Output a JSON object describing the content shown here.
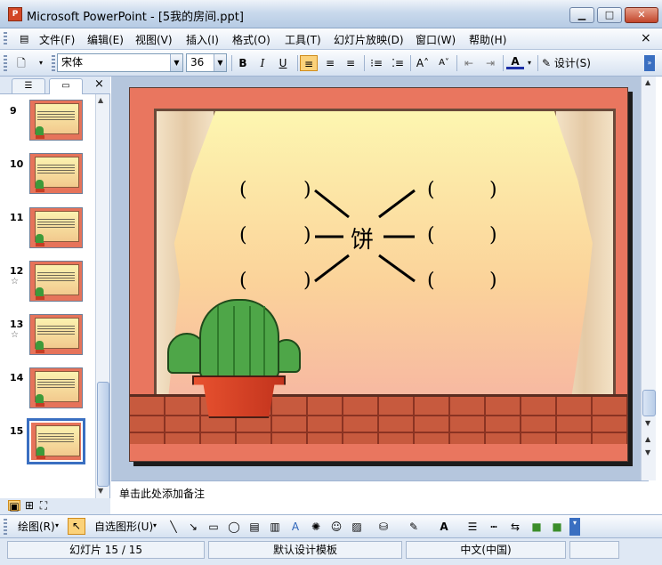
{
  "window": {
    "app_icon": "P",
    "title": "Microsoft PowerPoint - [5我的房间.ppt]",
    "min": "▁",
    "max": "□",
    "close": "✕"
  },
  "menu": {
    "items": [
      "文件(F)",
      "编辑(E)",
      "视图(V)",
      "插入(I)",
      "格式(O)",
      "工具(T)",
      "幻灯片放映(D)",
      "窗口(W)",
      "帮助(H)"
    ],
    "close": "×"
  },
  "toolbar": {
    "font_name": "宋体",
    "font_size": "36",
    "bold": "B",
    "italic": "I",
    "underline": "U",
    "design": "设计(S)"
  },
  "slides_pane": {
    "tab_outline": "☰",
    "tab_slides": "▭",
    "close": "×",
    "thumbnails": [
      {
        "num": "9",
        "star": ""
      },
      {
        "num": "10",
        "star": ""
      },
      {
        "num": "11",
        "star": ""
      },
      {
        "num": "12",
        "star": "☆"
      },
      {
        "num": "13",
        "star": "☆"
      },
      {
        "num": "14",
        "star": ""
      },
      {
        "num": "15",
        "star": ""
      }
    ]
  },
  "slide": {
    "center_char": "饼",
    "parens": [
      "(",
      ")",
      "(",
      ")",
      "(",
      ")",
      "(",
      ")",
      "(",
      ")",
      "(",
      ")",
      "(",
      ")",
      "(",
      ")",
      "(",
      ")",
      "(",
      ")",
      "(",
      ")",
      "(",
      ")"
    ]
  },
  "notes": {
    "placeholder": "单击此处添加备注"
  },
  "drawing": {
    "draw": "绘图(R)",
    "autoshapes": "自选图形(U)"
  },
  "status": {
    "slide": "幻灯片 15 / 15",
    "template": "默认设计模板",
    "language": "中文(中国)"
  },
  "colors": {
    "slide_bg": "#e9765f",
    "accent": "#3a6fc1"
  }
}
